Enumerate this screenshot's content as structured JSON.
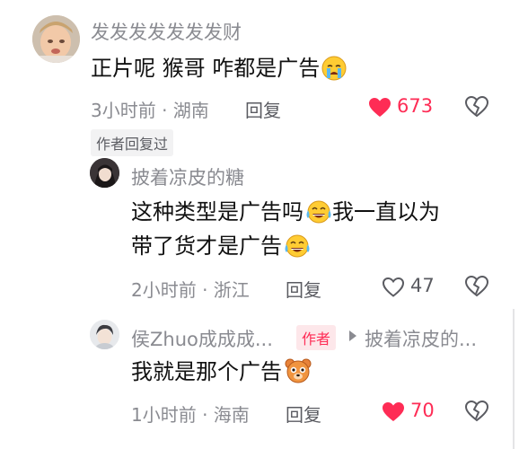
{
  "comments": [
    {
      "username": "发发发发发发发财",
      "text": "正片呢 猴哥 咋都是广告",
      "emoji": "crying-face",
      "time_location": "3小时前 · 湖南",
      "reply_label": "回复",
      "likes": "673",
      "liked": true,
      "badge": "作者回复过"
    },
    {
      "username": "披着凉皮的糖",
      "text_line1": "这种类型是广告吗",
      "text_line2_a": "我一直以为",
      "text_line2_b": "带了货才是广告",
      "emoji": "tears-of-joy",
      "time_location": "2小时前 · 浙江",
      "reply_label": "回复",
      "likes": "47",
      "liked": false
    },
    {
      "username": "侯Zhuo成成成...",
      "author_tag": "作者",
      "reply_to": "披着凉皮的...",
      "text": "我就是那个广告",
      "emoji": "bear-face",
      "time_location": "1小时前 · 海南",
      "reply_label": "回复",
      "likes": "70",
      "liked": true
    }
  ],
  "colors": {
    "like_red": "#fe2c55",
    "meta_gray": "#8a8b91",
    "author_tag_bg": "#fde7ea"
  }
}
